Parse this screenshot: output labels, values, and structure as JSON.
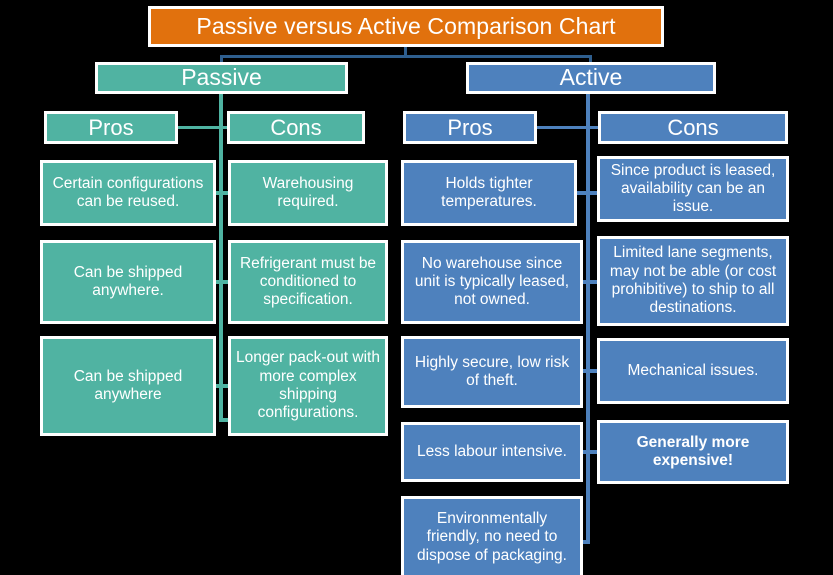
{
  "title": {
    "text": "Passive versus Active Comparison Chart",
    "color": "#E1710D"
  },
  "branches": [
    {
      "label": "Passive",
      "color": "#50B3A2"
    },
    {
      "label": "Active",
      "color": "#4E81BD"
    }
  ],
  "columns": {
    "passive_pros_header": "Pros",
    "passive_cons_header": "Cons",
    "active_pros_header": "Pros",
    "active_cons_header": "Cons"
  },
  "passive": {
    "pros": [
      "Certain configurations can be reused.",
      "Can be shipped anywhere.",
      "Can be shipped anywhere"
    ],
    "cons": [
      "Warehousing required.",
      "Refrigerant must be conditioned to specification.",
      "Longer pack-out with more complex shipping configurations."
    ]
  },
  "active": {
    "pros": [
      "Holds tighter temperatures.",
      "No warehouse since unit is typically leased, not owned.",
      "Highly secure, low risk of theft.",
      "Less labour intensive.",
      "Environmentally friendly, no need to dispose of packaging."
    ],
    "cons": [
      "Since product is leased, availability can be an issue.",
      "Limited lane segments, may not be able (or cost prohibitive) to ship to all destinations.",
      "Mechanical issues.",
      "Generally more expensive!"
    ]
  },
  "colors": {
    "background": "#000000",
    "title_orange": "#E1710D",
    "passive_teal": "#50B3A2",
    "active_blue": "#4E81BD",
    "connector_navy": "#2E5E8E",
    "box_border": "#FFFFFF",
    "text": "#FFFFFF"
  }
}
